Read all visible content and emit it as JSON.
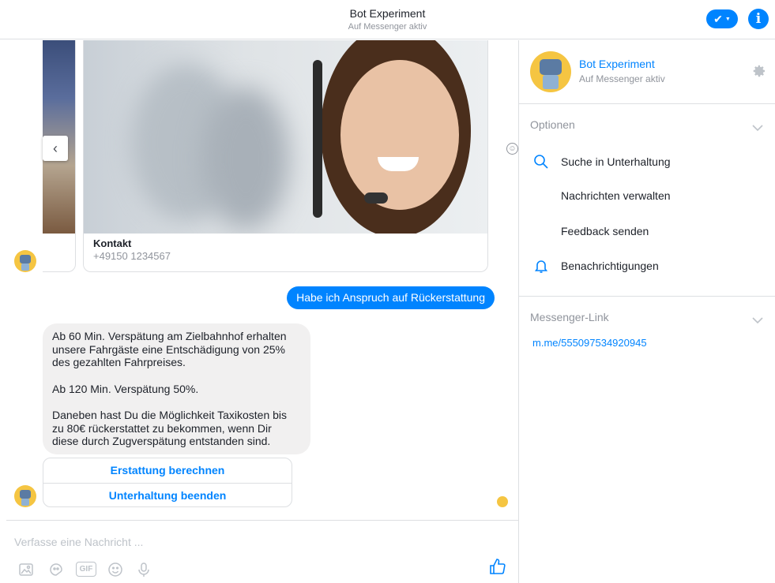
{
  "header": {
    "title": "Bot Experiment",
    "subtitle": "Auf Messenger aktiv"
  },
  "carousel": {
    "card_title": "Kontakt",
    "card_subtitle": "+49150 1234567"
  },
  "messages": {
    "outgoing": "Habe ich Anspruch auf Rückerstattung",
    "incoming": [
      "Ab 60 Min. Verspätung am Zielbahnhof erhalten unsere Fahrgäste eine Entschädigung von 25% des gezahlten Fahrpreises.",
      "Ab 120 Min. Verspätung 50%.",
      "Daneben hast Du die Möglichkeit Taxikosten bis zu 80€ rückerstattet zu bekommen, wenn Dir diese durch Zugverspätung entstanden sind."
    ]
  },
  "quick_replies": [
    "Erstattung berechnen",
    "Unterhaltung beenden"
  ],
  "composer": {
    "placeholder": "Verfasse eine Nachricht ...",
    "gif_label": "GIF"
  },
  "panel": {
    "name": "Bot Experiment",
    "status": "Auf Messenger aktiv",
    "options_title": "Optionen",
    "options": [
      {
        "label": "Suche in Unterhaltung",
        "icon": "search-icon"
      },
      {
        "label": "Nachrichten verwalten",
        "icon": ""
      },
      {
        "label": "Feedback senden",
        "icon": ""
      },
      {
        "label": "Benachrichtigungen",
        "icon": "bell-icon"
      }
    ],
    "link_title": "Messenger-Link",
    "link": "m.me/555097534920945"
  },
  "colors": {
    "accent": "#0084ff",
    "bubble_in": "#f1f0f0",
    "muted": "#90949c"
  }
}
